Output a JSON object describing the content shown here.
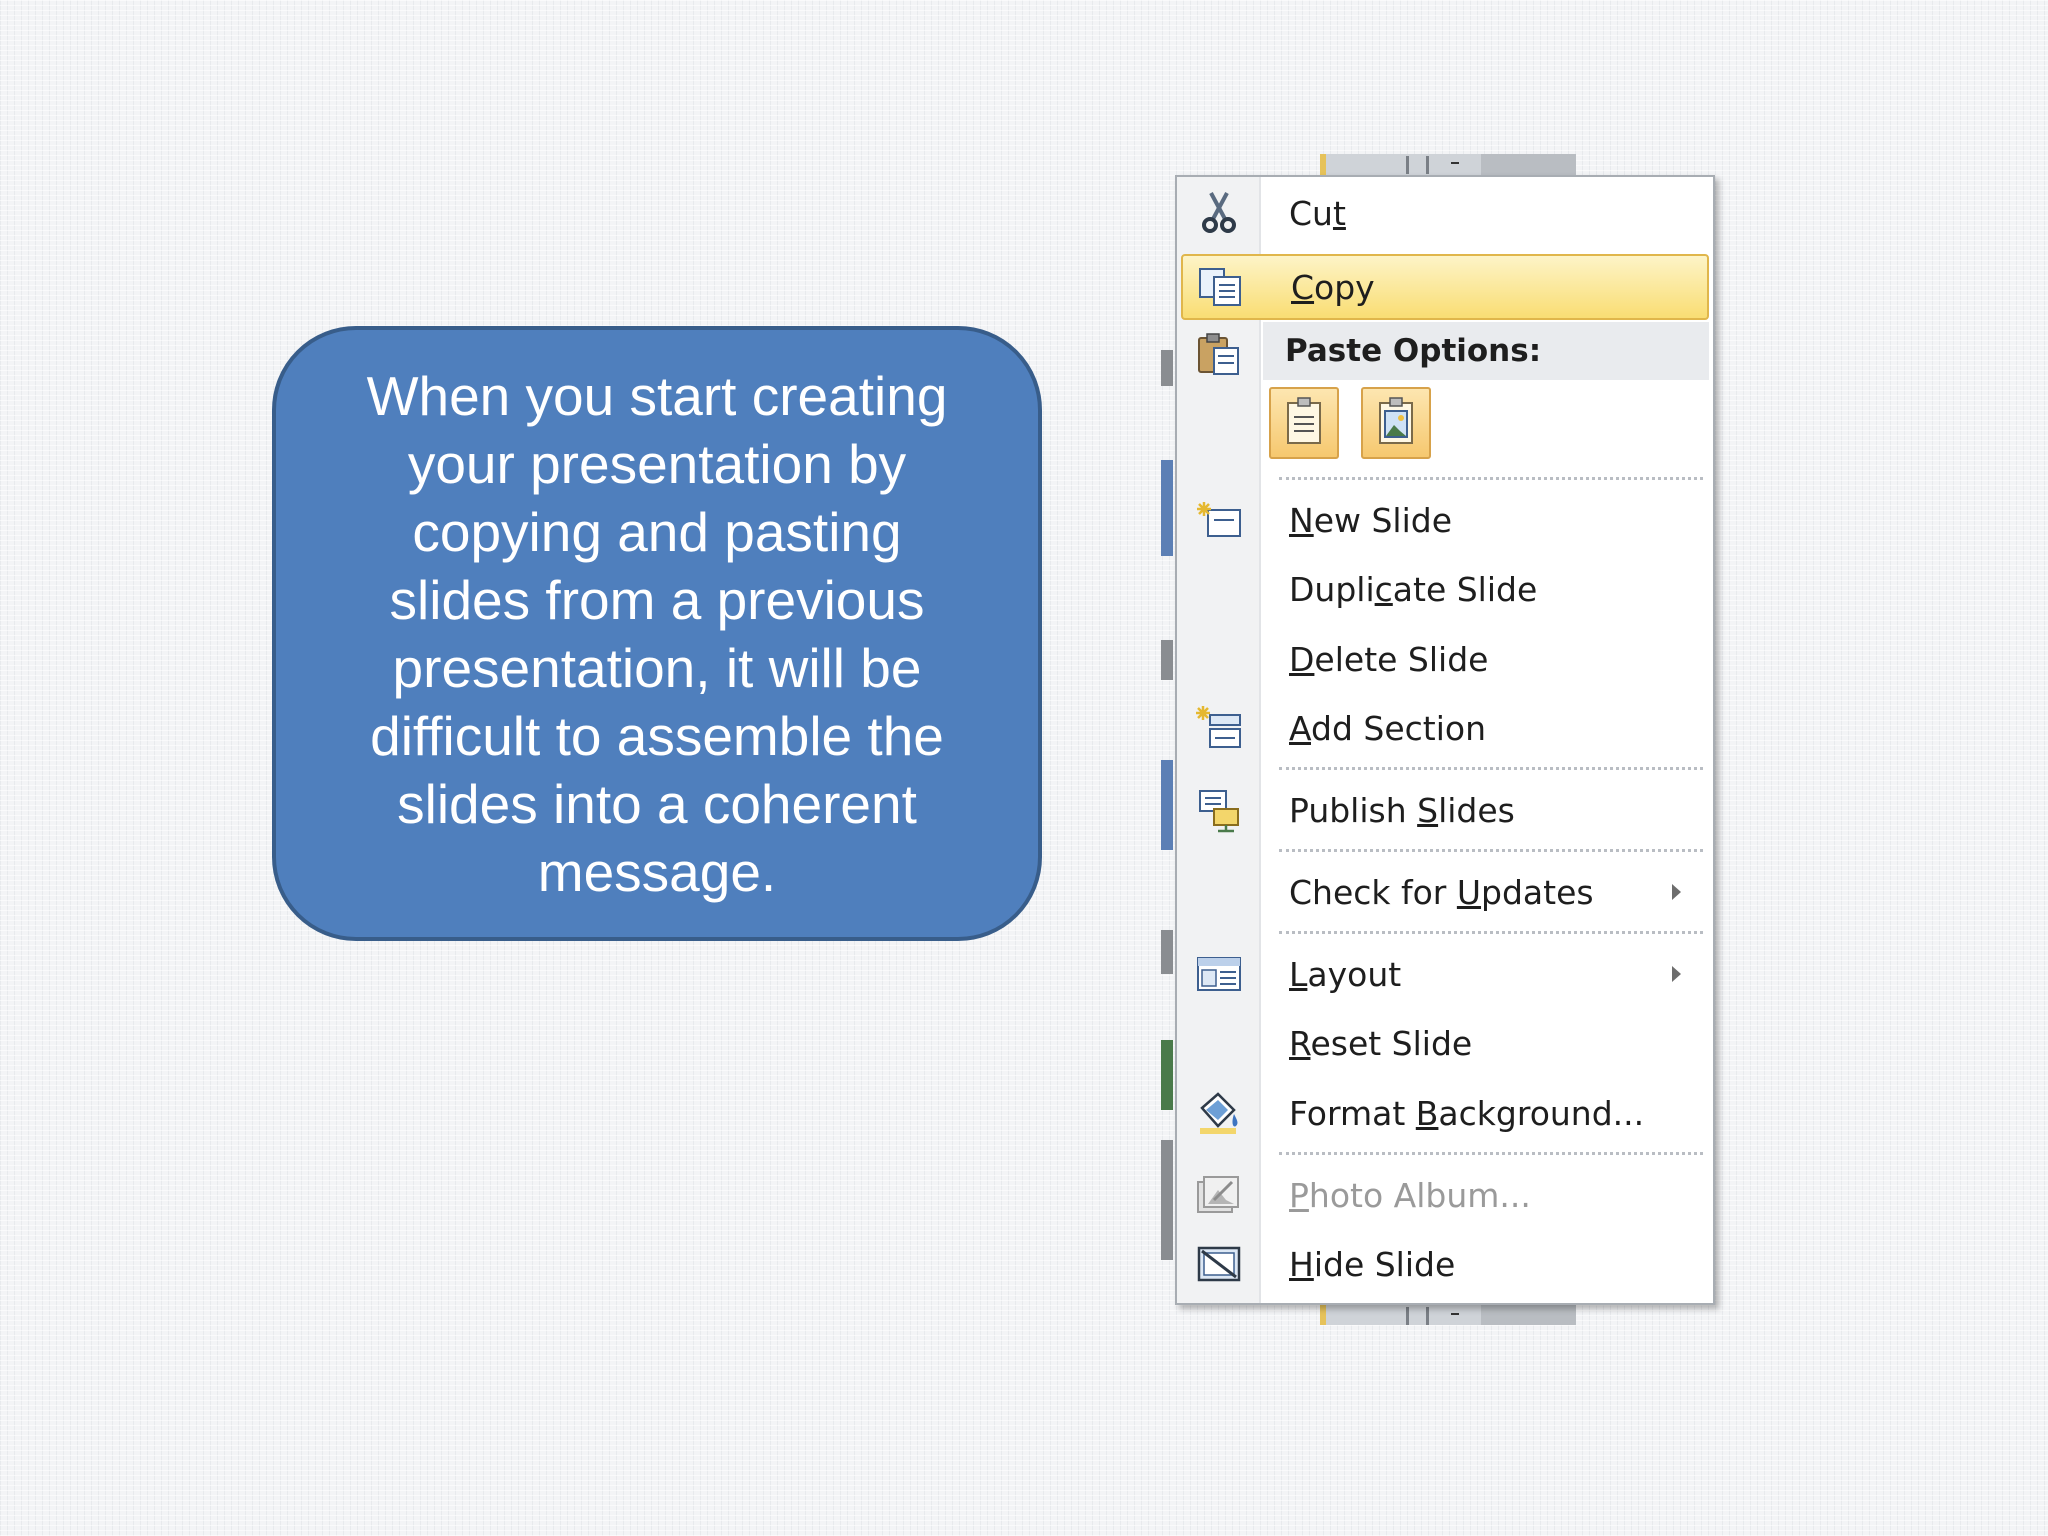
{
  "callout": {
    "text": "When you start creating\nyour presentation by\ncopying and pasting\nslides from a previous\npresentation, it will be\ndifficult to assemble the\nslides into a coherent\nmessage."
  },
  "menu": {
    "cut": {
      "pre": "Cu",
      "key": "t",
      "post": "",
      "icon": "scissors-icon"
    },
    "copy": {
      "pre": "",
      "key": "C",
      "post": "opy",
      "icon": "copy-icon"
    },
    "paste_header": {
      "label": "Paste Options:",
      "icon": "clipboard-icon"
    },
    "paste_options": [
      {
        "name": "paste-use-destination-theme",
        "icon": "paste-document-icon"
      },
      {
        "name": "paste-as-picture",
        "icon": "paste-picture-icon"
      }
    ],
    "new_slide": {
      "pre": "",
      "key": "N",
      "post": "ew Slide",
      "icon": "new-slide-icon"
    },
    "duplicate_slide": {
      "pre": "Dupli",
      "key": "c",
      "post": "ate Slide"
    },
    "delete_slide": {
      "pre": "",
      "key": "D",
      "post": "elete Slide"
    },
    "add_section": {
      "pre": "",
      "key": "A",
      "post": "dd Section",
      "icon": "add-section-icon"
    },
    "publish_slides": {
      "pre": "Publish ",
      "key": "S",
      "post": "lides",
      "icon": "publish-slides-icon"
    },
    "check_updates": {
      "pre": "Check for ",
      "key": "U",
      "post": "pdates"
    },
    "layout": {
      "pre": "",
      "key": "L",
      "post": "ayout",
      "icon": "layout-icon"
    },
    "reset_slide": {
      "pre": "",
      "key": "R",
      "post": "eset Slide"
    },
    "format_background": {
      "pre": "Format ",
      "key": "B",
      "post": "ackground...",
      "icon": "format-background-icon"
    },
    "photo_album": {
      "pre": "",
      "key": "P",
      "post": "hoto Album...",
      "icon": "photo-album-icon"
    },
    "hide_slide": {
      "pre": "",
      "key": "H",
      "post": "ide Slide",
      "icon": "hide-slide-icon"
    }
  },
  "colors": {
    "callout_fill": "#4f7fbd",
    "callout_border": "#385d8a",
    "highlight": "#f9dd73",
    "disabled_text": "#9a9a9a"
  }
}
